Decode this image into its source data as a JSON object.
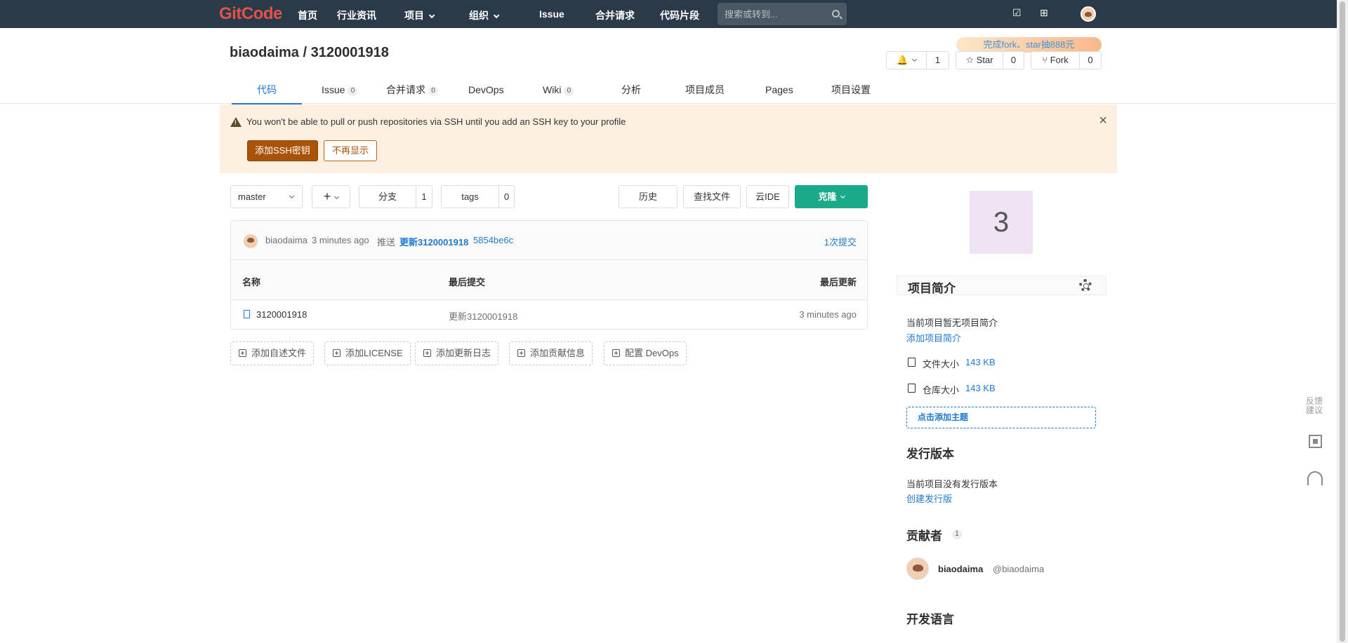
{
  "topbar": {
    "logo": "GitCode",
    "nav": [
      "首页",
      "行业资讯",
      "项目",
      "组织",
      "Issue",
      "合并请求",
      "代码片段"
    ],
    "search_placeholder": "搜索或转到..."
  },
  "header": {
    "project_title": "biaodaima / 3120001918",
    "promo": "完成fork、star抽888元",
    "notify_count": "1",
    "star_label": "Star",
    "star_count": "0",
    "fork_label": "Fork",
    "fork_count": "0"
  },
  "tabs": [
    {
      "label": "代码"
    },
    {
      "label": "Issue",
      "count": "0"
    },
    {
      "label": "合并请求",
      "count": "0"
    },
    {
      "label": "DevOps"
    },
    {
      "label": "Wiki",
      "count": "0"
    },
    {
      "label": "分析"
    },
    {
      "label": "项目成员"
    },
    {
      "label": "Pages"
    },
    {
      "label": "项目设置"
    }
  ],
  "alert": {
    "message": "You won't be able to pull or push repositories via SSH until you add an SSH key to your profile",
    "add_ssh_label": "添加SSH密钥",
    "dismiss_label": "不再显示"
  },
  "toolbar": {
    "branch": "master",
    "branches_label": "分支",
    "branches_count": "1",
    "tags_label": "tags",
    "tags_count": "0",
    "history_label": "历史",
    "find_file_label": "查找文件",
    "ide_label": "云IDE",
    "clone_label": "克隆"
  },
  "last_commit": {
    "author": "biaodaima",
    "time": "3 minutes ago",
    "action": "推送",
    "message": "更新3120001918",
    "sha": "5854be6c",
    "commits_link": "1次提交"
  },
  "file_table": {
    "headers": [
      "名称",
      "最后提交",
      "最后更新"
    ],
    "rows": [
      {
        "name": "3120001918",
        "commit": "更新3120001918",
        "updated": "3 minutes ago"
      }
    ]
  },
  "add_buttons": [
    "添加自述文件",
    "添加LICENSE",
    "添加更新日志",
    "添加贡献信息",
    "配置 DevOps"
  ],
  "sidebar": {
    "avatar_letter": "3",
    "intro_title": "项目简介",
    "no_intro": "当前项目暂无项目简介",
    "add_intro": "添加项目简介",
    "file_size_label": "文件大小",
    "file_size": "143 KB",
    "repo_size_label": "仓库大小",
    "repo_size": "143 KB",
    "add_topic": "点击添加主题",
    "release_title": "发行版本",
    "no_release": "当前项目没有发行版本",
    "create_release": "创建发行版",
    "contrib_title": "贡献者",
    "contrib_count": "1",
    "contributor_name": "biaodaima",
    "contributor_handle": "@biaodaima",
    "lang_title": "开发语言"
  },
  "floating": {
    "feedback": "反馈建议"
  }
}
